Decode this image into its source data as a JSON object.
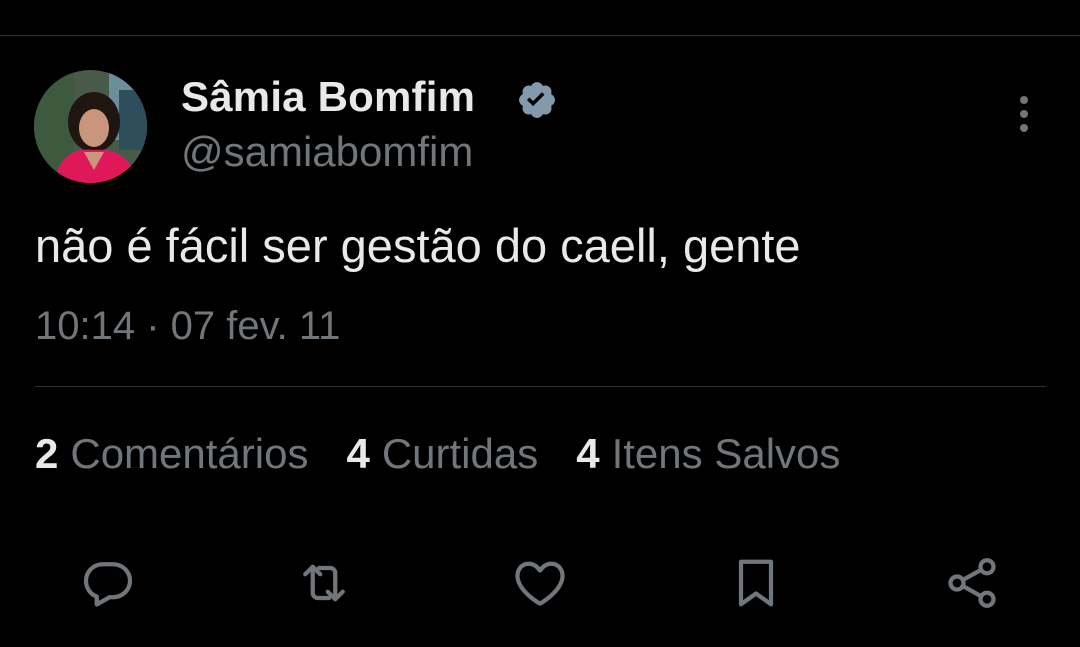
{
  "tweet": {
    "author": {
      "name": "Sâmia Bomfim",
      "handle": "@samiabomfim",
      "verified": true,
      "verified_color": "#829aab"
    },
    "text": "não é fácil ser gestão do caell, gente",
    "timestamp": "10:14 · 07 fev. 11",
    "stats": [
      {
        "count": "2",
        "label": "Comentários"
      },
      {
        "count": "4",
        "label": "Curtidas"
      },
      {
        "count": "4",
        "label": "Itens Salvos"
      }
    ],
    "actions": [
      "reply-icon",
      "retweet-icon",
      "like-icon",
      "bookmark-icon",
      "share-icon"
    ]
  },
  "colors": {
    "background": "#000000",
    "primary_text": "#e7e9ea",
    "secondary_text": "#71767b",
    "divider": "#2f3336"
  }
}
